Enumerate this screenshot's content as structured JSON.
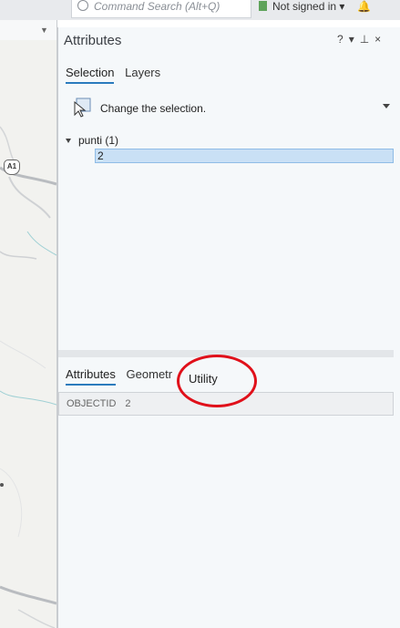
{
  "toolbar": {
    "search_placeholder": "Command Search (Alt+Q)",
    "signin_label": "Not signed in",
    "signin_caret": "▾"
  },
  "map": {
    "route_shield": "A1"
  },
  "pane": {
    "title": "Attributes",
    "help": "?",
    "menu": "▾",
    "pin": "⊥",
    "close": "×",
    "tabs": [
      {
        "label": "Selection",
        "active": true
      },
      {
        "label": "Layers",
        "active": false
      }
    ],
    "change_selection": "Change the selection.",
    "tree": {
      "layer_label": "punti (1)",
      "item": "2"
    },
    "lower_tabs": [
      {
        "label": "Attributes",
        "active": true
      },
      {
        "label": "Geometr",
        "active": false
      }
    ],
    "utility_label": "Utility",
    "field": {
      "name": "OBJECTID",
      "value": "2"
    }
  }
}
